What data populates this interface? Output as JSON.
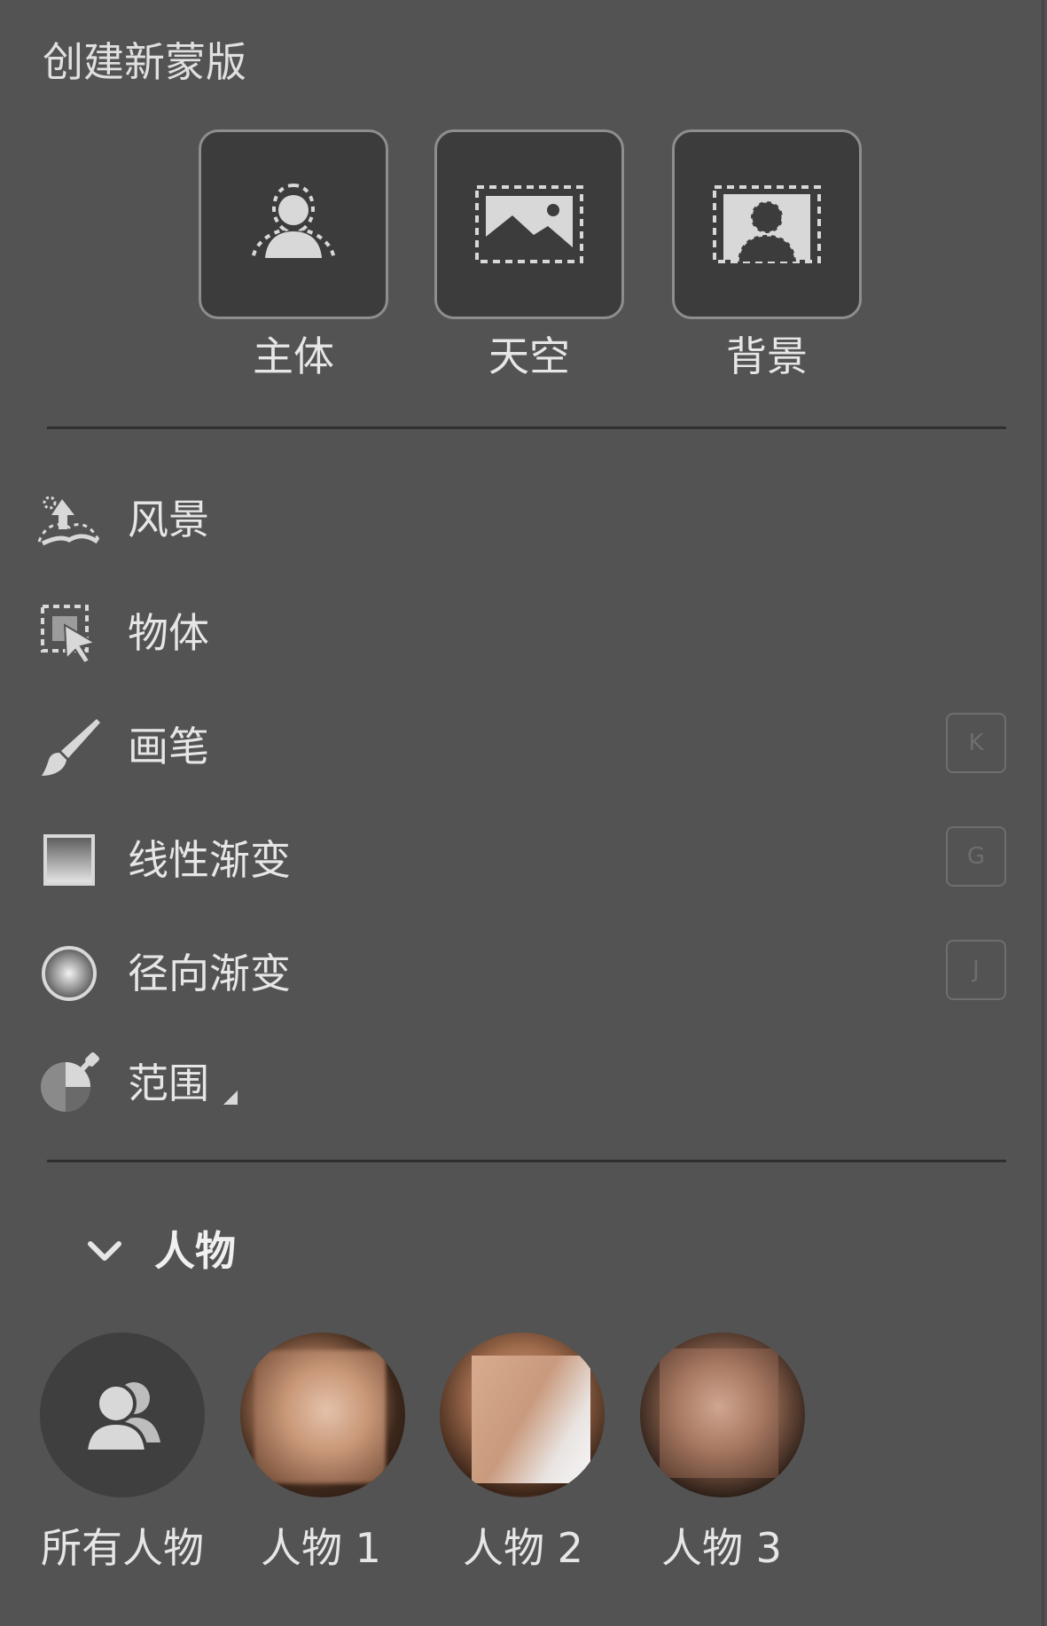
{
  "panel": {
    "title": "创建新蒙版"
  },
  "quick_masks": [
    {
      "label": "主体",
      "icon": "subject-icon"
    },
    {
      "label": "天空",
      "icon": "sky-icon"
    },
    {
      "label": "背景",
      "icon": "background-icon"
    }
  ],
  "tools": [
    {
      "label": "风景",
      "icon": "landscape-icon",
      "shortcut": ""
    },
    {
      "label": "物体",
      "icon": "object-select-icon",
      "shortcut": ""
    },
    {
      "label": "画笔",
      "icon": "brush-icon",
      "shortcut": "K"
    },
    {
      "label": "线性渐变",
      "icon": "linear-gradient-icon",
      "shortcut": "G"
    },
    {
      "label": "径向渐变",
      "icon": "radial-gradient-icon",
      "shortcut": "J"
    },
    {
      "label": "范围",
      "icon": "range-icon",
      "shortcut": ""
    }
  ],
  "people_group": {
    "label": "人物",
    "people": [
      {
        "label": "所有人物",
        "icon": "all-people-icon"
      },
      {
        "label": "人物 1"
      },
      {
        "label": "人物 2"
      },
      {
        "label": "人物 3"
      }
    ]
  },
  "colors": {
    "panel_bg": "#535353",
    "tile_bg": "#3c3c3c",
    "tile_border": "#8e8e8e",
    "icon": "#d8d8d8",
    "shortcut": "#6e6e6e"
  }
}
